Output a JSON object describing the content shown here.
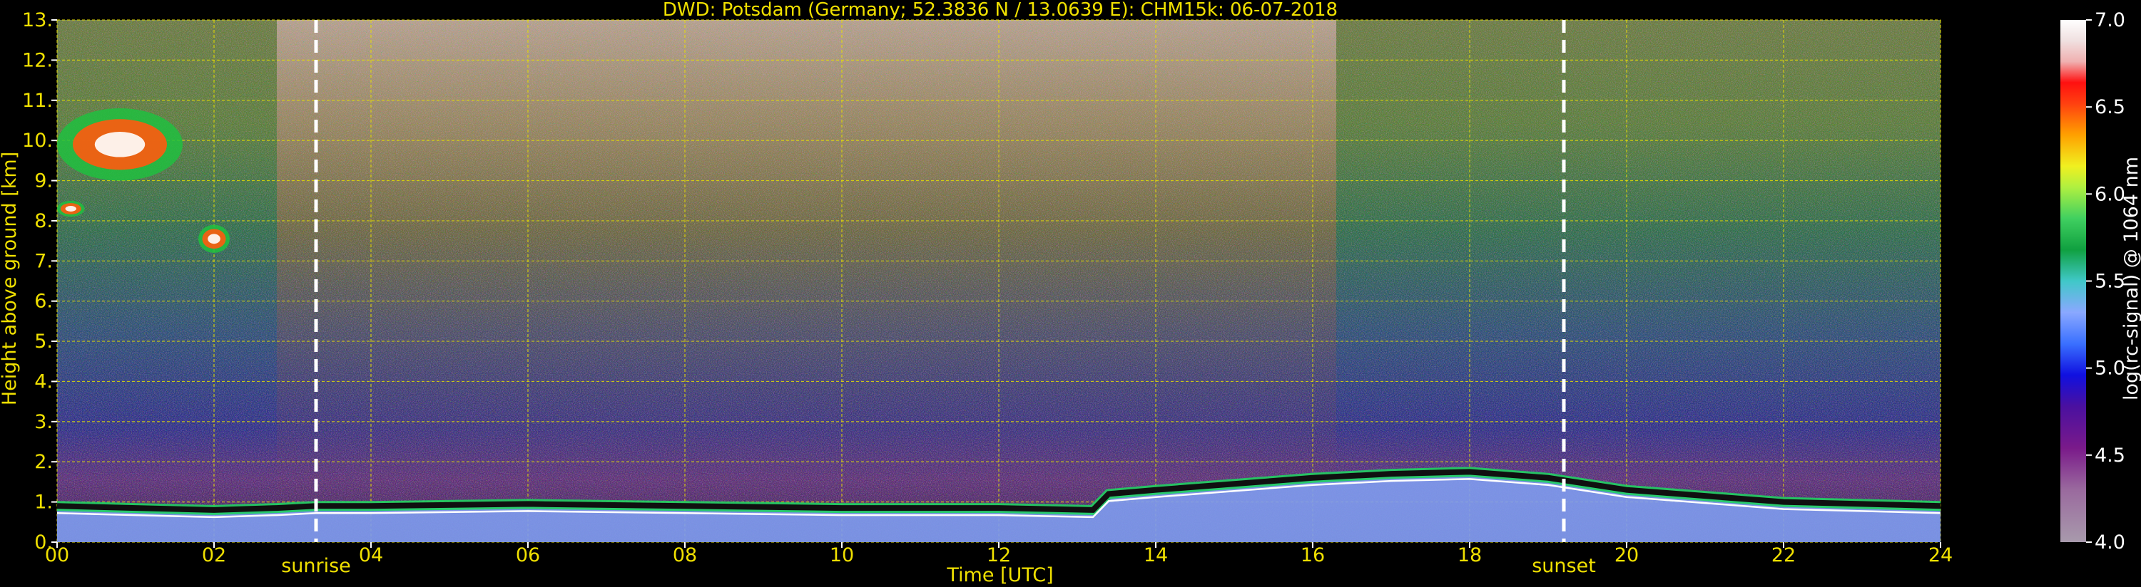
{
  "chart_data": {
    "type": "heatmap",
    "title": "DWD: Potsdam (Germany; 52.3836 N / 13.0639 E):    CHM15k: 06-07-2018",
    "xlabel": "Time [UTC]",
    "ylabel": "Height above ground [km]",
    "xlim": [
      0,
      24
    ],
    "ylim": [
      0,
      13
    ],
    "xticks": [
      "00",
      "02",
      "04",
      "06",
      "08",
      "10",
      "12",
      "14",
      "16",
      "18",
      "20",
      "22",
      "24"
    ],
    "yticks": [
      "0.",
      "1.",
      "2.",
      "3.",
      "4.",
      "5.",
      "6.",
      "7.",
      "8.",
      "9.",
      "10.",
      "11.",
      "12.",
      "13."
    ],
    "grid": true,
    "markers": [
      {
        "label": "sunrise",
        "x": 3.3
      },
      {
        "label": "sunset",
        "x": 19.2
      }
    ],
    "colorbar": {
      "label": "log(rc-signal) @ 1064 nm",
      "range": [
        4.0,
        7.0
      ],
      "ticks": [
        "4.0",
        "4.5",
        "5.0",
        "5.5",
        "6.0",
        "6.5",
        "7.0"
      ]
    },
    "boundary_layer_top_km": [
      [
        0.0,
        0.9
      ],
      [
        1.0,
        0.85
      ],
      [
        2.0,
        0.8
      ],
      [
        2.8,
        0.85
      ],
      [
        3.3,
        0.9
      ],
      [
        4.0,
        0.9
      ],
      [
        6.0,
        0.95
      ],
      [
        8.0,
        0.9
      ],
      [
        10.0,
        0.85
      ],
      [
        12.0,
        0.85
      ],
      [
        13.2,
        0.8
      ],
      [
        13.4,
        1.2
      ],
      [
        14.0,
        1.3
      ],
      [
        15.0,
        1.45
      ],
      [
        16.0,
        1.6
      ],
      [
        17.0,
        1.7
      ],
      [
        18.0,
        1.75
      ],
      [
        19.0,
        1.6
      ],
      [
        20.0,
        1.3
      ],
      [
        21.0,
        1.15
      ],
      [
        22.0,
        1.0
      ],
      [
        24.0,
        0.9
      ]
    ],
    "cloud_features": [
      {
        "t_start": 0.0,
        "t_end": 1.6,
        "h_min": 9.0,
        "h_max": 10.8
      },
      {
        "t_start": 0.0,
        "t_end": 0.35,
        "h_min": 8.1,
        "h_max": 8.5
      },
      {
        "t_start": 1.8,
        "t_end": 2.2,
        "h_min": 7.2,
        "h_max": 7.9
      }
    ]
  }
}
